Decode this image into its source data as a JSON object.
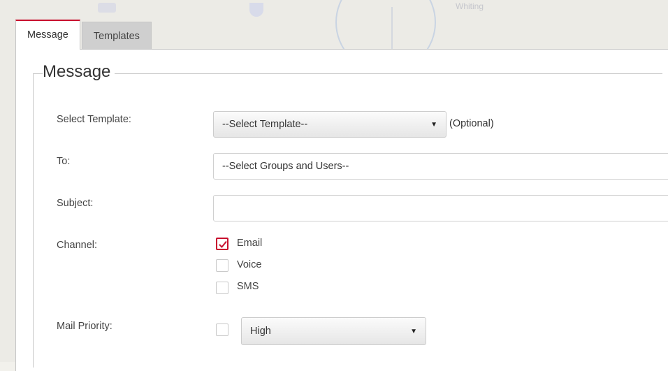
{
  "tabs": [
    {
      "label": "Message",
      "active": true
    },
    {
      "label": "Templates",
      "active": false
    }
  ],
  "section_title": "Message",
  "fields": {
    "template": {
      "label": "Select Template:",
      "value": "--Select Template--",
      "hint": "(Optional)"
    },
    "to": {
      "label": "To:",
      "value": "--Select Groups and Users--"
    },
    "subject": {
      "label": "Subject:",
      "value": ""
    },
    "channel": {
      "label": "Channel:",
      "options": [
        {
          "label": "Email",
          "checked": true
        },
        {
          "label": "Voice",
          "checked": false
        },
        {
          "label": "SMS",
          "checked": false
        }
      ]
    },
    "priority": {
      "label": "Mail Priority:",
      "enabled": false,
      "value": "High"
    }
  },
  "colors": {
    "accent": "#c8102e"
  },
  "map_label": "Whiting"
}
